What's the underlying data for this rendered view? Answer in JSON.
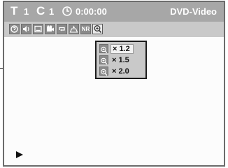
{
  "status_bar": {
    "title_icon": "T",
    "title_number": "1",
    "chapter_icon": "C",
    "chapter_number": "1",
    "clock_icon": "clock-icon",
    "elapsed_time": "0:00:00",
    "disc_type": "DVD-Video"
  },
  "toolbar": {
    "icons": [
      "search-icon",
      "audio-icon",
      "subtitle-icon",
      "camera-angle-icon",
      "repeat-icon",
      "marker-icon",
      "noise-reduction-icon",
      "zoom-icon"
    ],
    "nr_label": "NR",
    "selected": "zoom-icon"
  },
  "zoom_menu": {
    "options": [
      {
        "label": "× 1.2",
        "icon": "zoom-icon"
      },
      {
        "label": "× 1.5",
        "icon": "zoom-icon"
      },
      {
        "label": "× 2.0",
        "icon": "zoom-icon"
      }
    ],
    "selected_index": 0
  },
  "playback": {
    "state_icon": "play-icon"
  },
  "colors": {
    "bar_background": "#a7a7a7",
    "icon_row_background": "#c9c9c9",
    "screen_border": "#6b6b6b",
    "panel_border": "#1c1c1c"
  }
}
